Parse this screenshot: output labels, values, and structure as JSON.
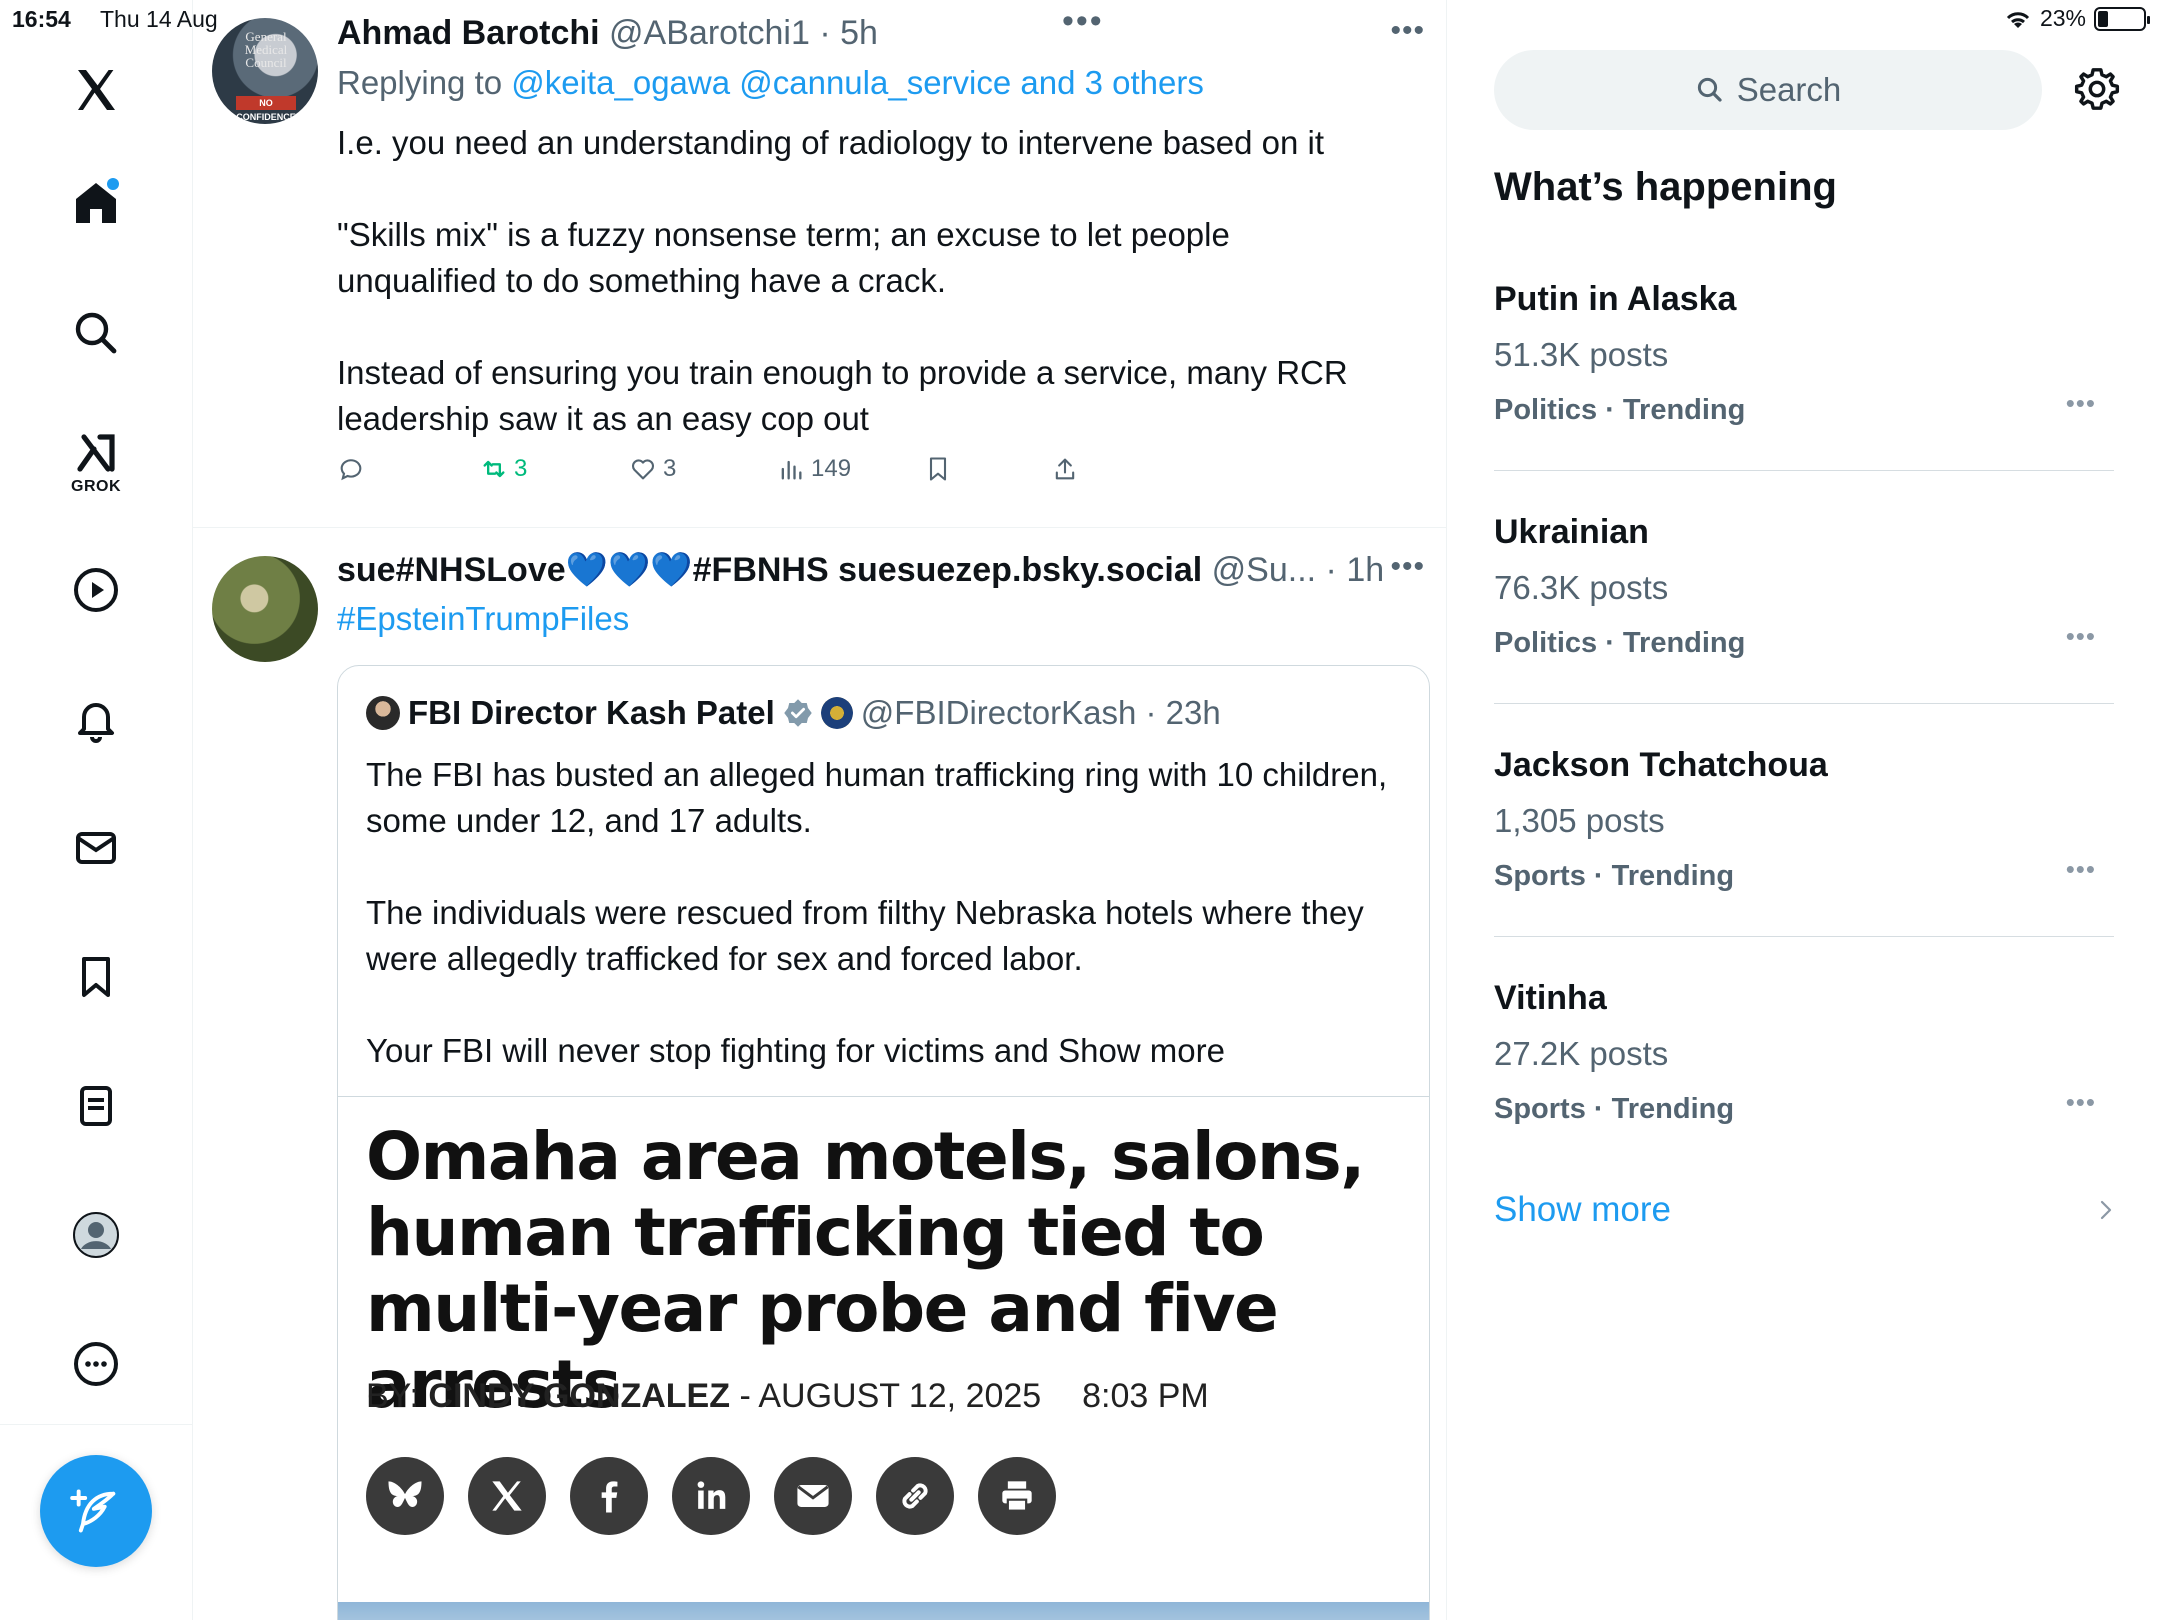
{
  "status_bar": {
    "time": "16:54",
    "date": "Thu 14 Aug",
    "battery": "23%",
    "battery_level": 0.23
  },
  "nav": {
    "grok_label": "GROK",
    "items": [
      "x-logo",
      "home",
      "search",
      "grok",
      "video",
      "notifications",
      "messages",
      "bookmarks",
      "lists",
      "profile",
      "more"
    ]
  },
  "posts": [
    {
      "name": "Ahmad Barotchi",
      "meta": "@ABarotchi1 · 5h",
      "reply_prefix": "Replying to",
      "reply_to": "@keita_ogawa @cannula_service and 3 others",
      "avatar_caption": "General Medical Council",
      "avatar_banner": "NO CONFIDENCE",
      "text": "I.e. you need an understanding of radiology to intervene based on it\n\n\"Skills mix\" is a fuzzy nonsense term; an excuse to let people unqualified to do something have a crack.\n\nInstead of ensuring you train enough to provide a service, many RCR leadership saw it as an easy cop out",
      "retweets": "3",
      "likes": "3",
      "views": "149"
    },
    {
      "name": "sue#NHSLove💙💙💙#FBNHS suesuezep.bsky.social",
      "meta": "@Su... · 1h",
      "hashtag": "#EpsteinTrumpFiles",
      "quote": {
        "name": "FBI Director Kash Patel",
        "meta": "@FBIDirectorKash · 23h",
        "text": "The FBI has busted an alleged human trafficking ring with 10 children, some under 12, and 17 adults.\n\nThe individuals were rescued from filthy Nebraska hotels where they were allegedly trafficked for sex and forced labor.\n\nYour FBI will never stop fighting for victims and Show more",
        "article": {
          "title": "Omaha area motels, salons, human trafficking tied to multi-year probe and five arrests",
          "by_label": "BY:",
          "author": "CINDY GONZALEZ",
          "date": "- AUGUST 12, 2025",
          "time": "8:03 PM"
        }
      }
    }
  ],
  "right": {
    "search_placeholder": "Search",
    "heading": "What’s happening",
    "trends": [
      {
        "title": "Putin in Alaska",
        "count": "51.3K posts",
        "category": "Politics · Trending"
      },
      {
        "title": "Ukrainian",
        "count": "76.3K posts",
        "category": "Politics · Trending"
      },
      {
        "title": "Jackson Tchatchoua",
        "count": "1,305 posts",
        "category": "Sports · Trending"
      },
      {
        "title": "Vitinha",
        "count": "27.2K posts",
        "category": "Sports · Trending"
      }
    ],
    "show_more": "Show more"
  },
  "colors": {
    "accent": "#1d9bf0",
    "retweet_green": "#00ba7c",
    "muted": "#536471"
  }
}
